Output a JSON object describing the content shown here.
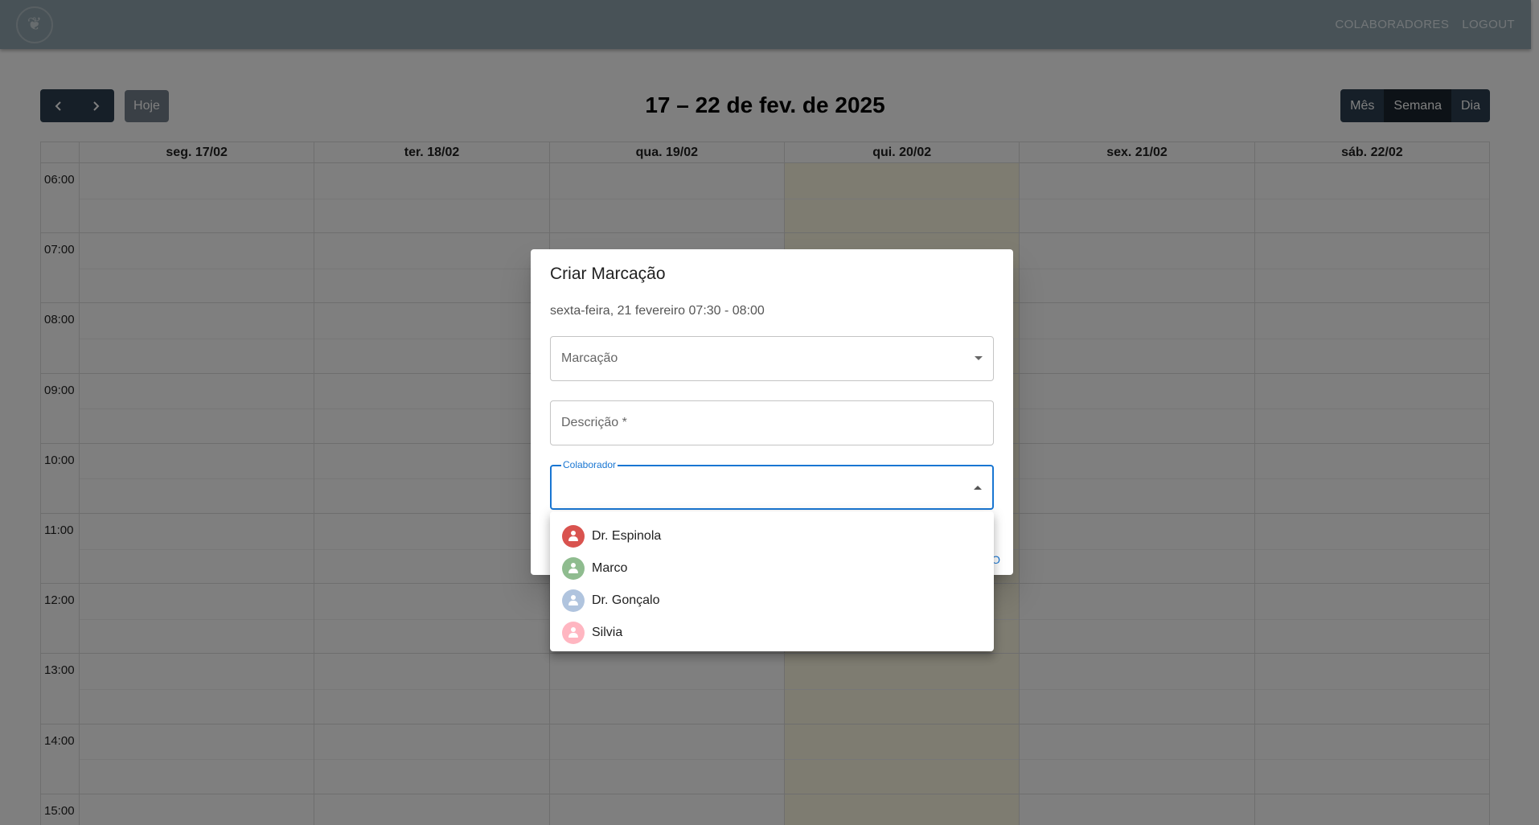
{
  "app": {
    "nav": [
      "COLABORADORES",
      "LOGOUT"
    ]
  },
  "calendar": {
    "today_label": "Hoje",
    "title": "17 – 22 de fev. de 2025",
    "views": [
      "Mês",
      "Semana",
      "Dia"
    ],
    "active_view": "Semana",
    "days": [
      "seg. 17/02",
      "ter. 18/02",
      "qua. 19/02",
      "qui. 20/02",
      "sex. 21/02",
      "sáb. 22/02"
    ],
    "today_index": 3,
    "hours": [
      "06:00",
      "07:00",
      "08:00",
      "09:00",
      "10:00",
      "11:00",
      "12:00",
      "13:00",
      "14:00",
      "15:00"
    ]
  },
  "dialog": {
    "title": "Criar Marcação",
    "subtitle": "sexta-feira, 21 fevereiro 07:30 - 08:00",
    "type_placeholder": "Marcação",
    "description_placeholder": "Descrição *",
    "collaborator_label": "Colaborador",
    "action_fragment": "O"
  },
  "collaborators": [
    {
      "name": "Dr. Espinola",
      "color": "#d9534f"
    },
    {
      "name": "Marco",
      "color": "#8fbc8f"
    },
    {
      "name": "Dr. Gonçalo",
      "color": "#b0c4de"
    },
    {
      "name": "Silvia",
      "color": "#ffb6c1"
    }
  ]
}
